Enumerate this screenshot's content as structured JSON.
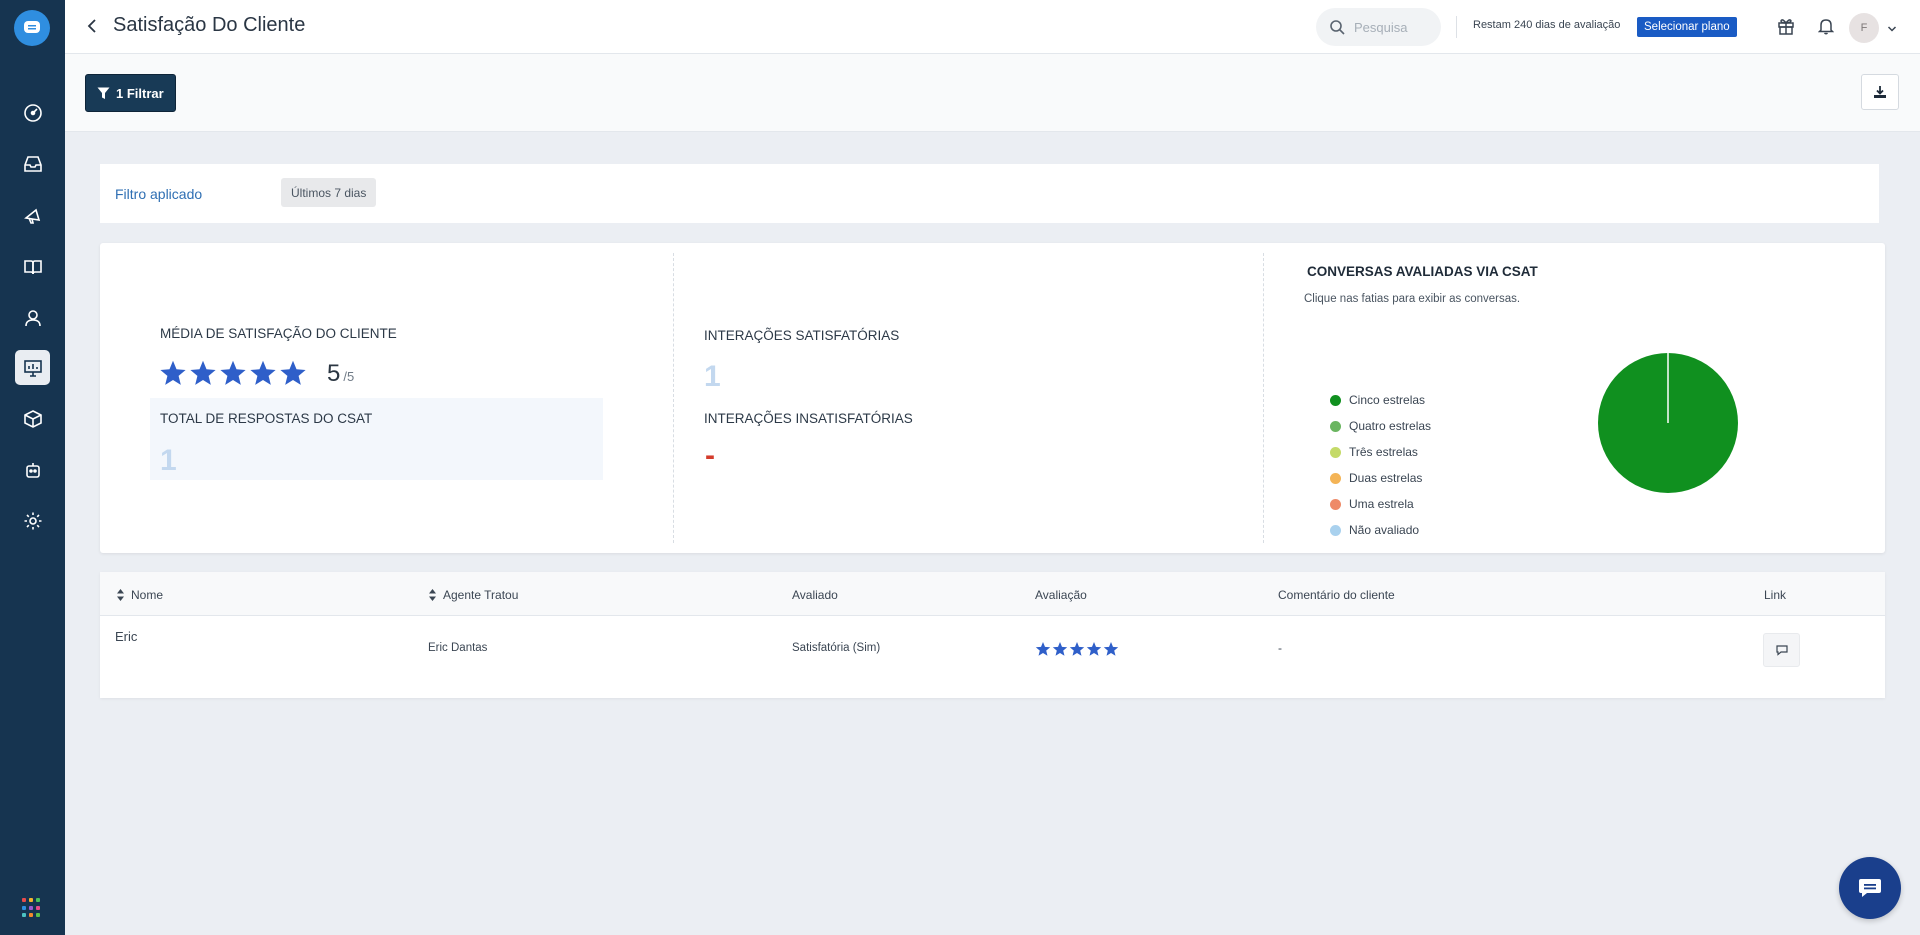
{
  "header": {
    "title": "Satisfação Do Cliente",
    "search_placeholder": "Pesquisa",
    "trial_text": "Restam 240 dias de avaliação",
    "plan_button": "Selecionar plano",
    "avatar_initial": "F"
  },
  "toolbar": {
    "filter_label": "1 Filtrar"
  },
  "applied_filter": {
    "label": "Filtro aplicado",
    "chip": "Últimos 7 dias"
  },
  "stats": {
    "avg_label": "MÉDIA DE SATISFAÇÃO DO CLIENTE",
    "avg_stars": 5,
    "avg_value": "5",
    "avg_max": "/5",
    "total_label": "TOTAL DE RESPOSTAS DO CSAT",
    "total_value": "1",
    "satisfied_label": "INTERAÇÕES SATISFATÓRIAS",
    "satisfied_value": "1",
    "unsatisfied_label": "INTERAÇÕES INSATISFATÓRIAS",
    "unsatisfied_value": "-"
  },
  "chart": {
    "title": "CONVERSAS AVALIADAS VIA CSAT",
    "subtitle": "Clique nas fatias para exibir as conversas."
  },
  "chart_data": {
    "type": "pie",
    "categories": [
      "Cinco estrelas",
      "Quatro estrelas",
      "Três estrelas",
      "Duas estrelas",
      "Uma estrela",
      "Não avaliado"
    ],
    "values": [
      1,
      0,
      0,
      0,
      0,
      0
    ],
    "colors": [
      "#10901f",
      "#6ab560",
      "#c4da68",
      "#f4b456",
      "#ee8a68",
      "#a9d1ee"
    ],
    "legend_position": "left"
  },
  "table": {
    "columns": [
      "Nome",
      "Agente Tratou",
      "Avaliado",
      "Avaliação",
      "Comentário do cliente",
      "Link"
    ],
    "rows": [
      {
        "nome": "Eric",
        "agente": "Eric Dantas",
        "avaliado": "Satisfatória (Sim)",
        "avaliacao_stars": 5,
        "comentario": "-"
      }
    ]
  },
  "icons": {
    "sidebar": [
      "dashboard-icon",
      "inbox-icon",
      "megaphone-icon",
      "book-icon",
      "contact-icon",
      "reports-icon",
      "package-icon",
      "bot-icon",
      "settings-icon"
    ],
    "top": [
      "search-icon",
      "gift-icon",
      "bell-icon",
      "chevron-down-icon"
    ],
    "brand_color": "#163450",
    "accent_color": "#1a5bc4",
    "star_color": "#2f5fc9"
  }
}
